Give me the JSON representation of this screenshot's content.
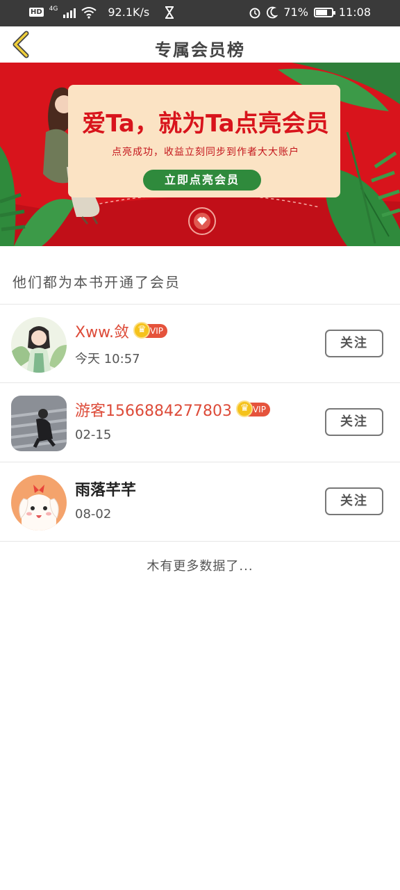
{
  "status_bar": {
    "hd": "HD",
    "network": "4G",
    "speed": "92.1K/s",
    "battery_percent": "71%",
    "battery_level": 0.71,
    "time": "11:08"
  },
  "header": {
    "title": "专属会员榜",
    "back_icon": "chevron-left-icon"
  },
  "banner": {
    "headline": "爱Ta，就为Ta点亮会员",
    "subtitle": "点亮成功，收益立刻同步到作者大大账户",
    "cta_label": "立即点亮会员"
  },
  "section_title": "他们都为本书开通了会员",
  "members": [
    {
      "name": "Xww.敛",
      "vip": true,
      "vip_label": "VIP",
      "date": "今天 10:57",
      "follow_label": "关注"
    },
    {
      "name": "游客1566884277803",
      "vip": true,
      "vip_label": "VIP",
      "date": "02-15",
      "follow_label": "关注"
    },
    {
      "name": "雨落芊芊",
      "vip": false,
      "date": "08-02",
      "follow_label": "关注"
    }
  ],
  "footer_text": "木有更多数据了...",
  "colors": {
    "accent_red": "#d8141c",
    "vip_name": "#dd4b39",
    "cta_green": "#2f8a3c",
    "status_bar": "#3a3a3a"
  }
}
